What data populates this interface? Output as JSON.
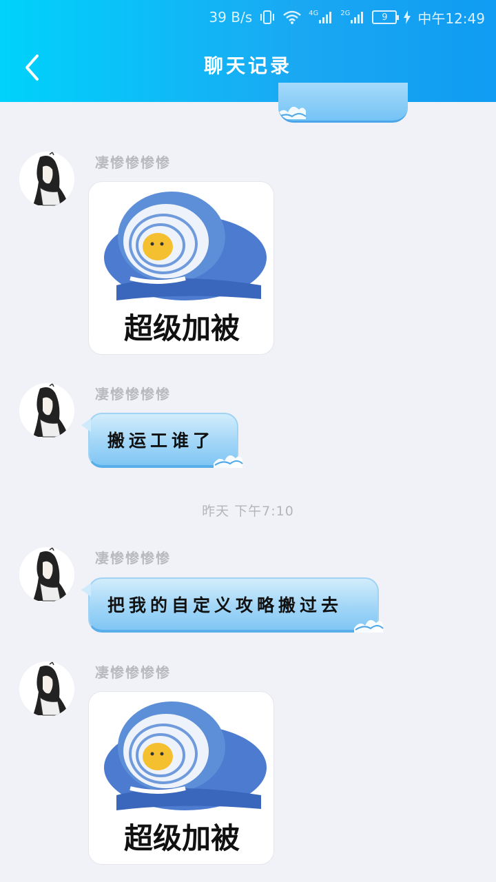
{
  "status_bar": {
    "speed": "39 B/s",
    "net1": "4G",
    "net2": "2G",
    "battery": "9",
    "time": "中午12:49"
  },
  "header": {
    "title": "聊天记录",
    "back_icon": "chevron-left-icon"
  },
  "colors": {
    "header_start": "#00d2fb",
    "header_end": "#0f9cf2",
    "background": "#f1f2f7",
    "bubble_blue": "#a2d6f7"
  },
  "messages": [
    {
      "sender": "凄惨惨惨惨",
      "type": "sticker",
      "caption": "超级加被"
    },
    {
      "sender": "凄惨惨惨惨",
      "type": "text",
      "text": "搬运工谁了"
    },
    {
      "sender": "凄惨惨惨惨",
      "type": "text",
      "text": "把我的自定义攻略搬过去"
    },
    {
      "sender": "凄惨惨惨惨",
      "type": "sticker",
      "caption": "超级加被"
    }
  ],
  "timestamp": "昨天 下午7:10"
}
